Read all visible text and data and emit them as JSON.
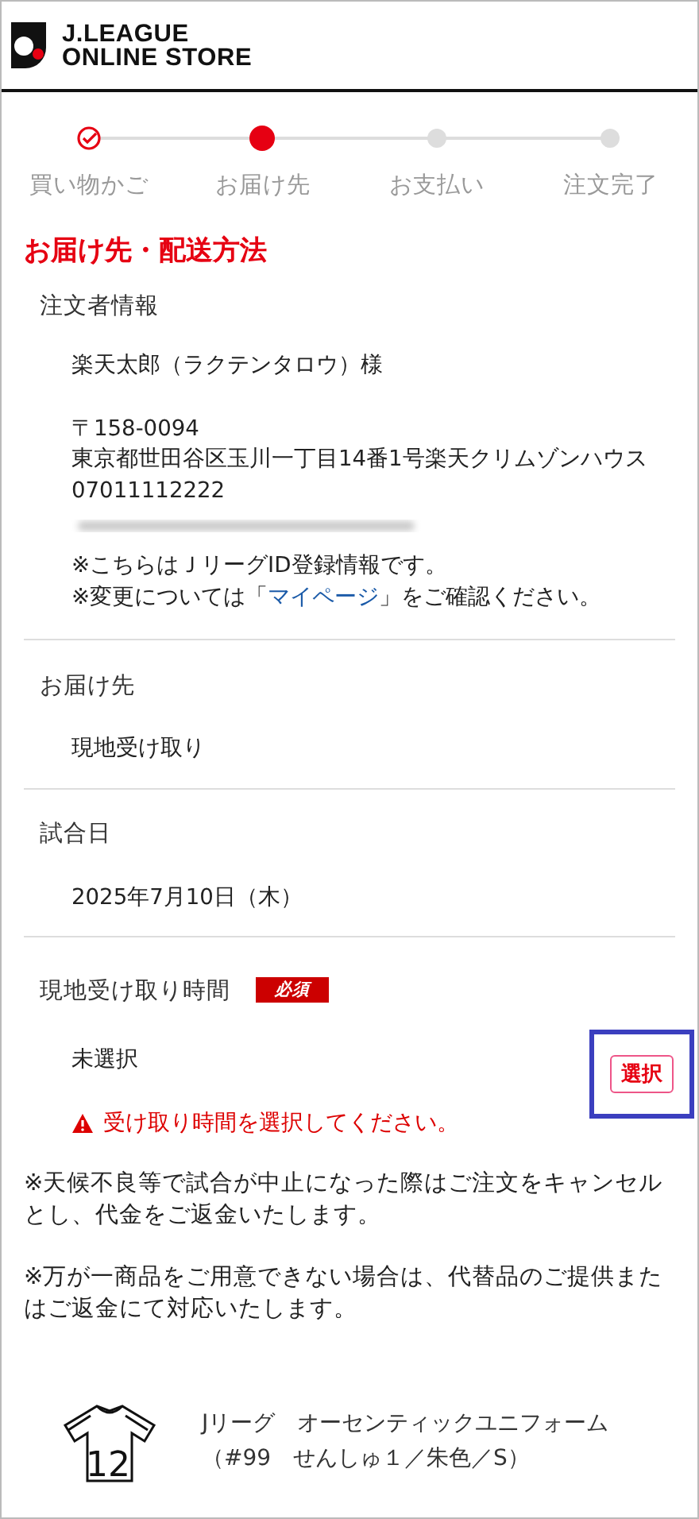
{
  "header": {
    "logo_line_1": "J.LEAGUE",
    "logo_line_2": "ONLINE STORE"
  },
  "steps": [
    {
      "label": "買い物かご",
      "kind": "done"
    },
    {
      "label": "お届け先",
      "kind": "current"
    },
    {
      "label": "お支払い",
      "kind": "todo"
    },
    {
      "label": "注文完了",
      "kind": "todo"
    }
  ],
  "page_title": "お届け先・配送方法",
  "orderer": {
    "heading": "注文者情報",
    "name": "楽天太郎（ラクテンタロウ）様",
    "address_lines": [
      "〒158-0094",
      "東京都世田谷区玉川一丁目14番1号楽天クリムゾンハウス",
      "07011112222"
    ],
    "notes": [
      {
        "text": "※こちらはＪリーグID登録情報です。"
      },
      {
        "text": "※変更については「",
        "link": "マイページ",
        "after": "」をご確認ください。"
      }
    ]
  },
  "sections": [
    {
      "heading": "お届け先",
      "value": "現地受け取り"
    },
    {
      "heading": "試合日",
      "value": "2025年7月10日（木）"
    }
  ],
  "pickup_time": {
    "heading": "現地受け取り時間",
    "badge": "必須",
    "value": "未選択",
    "error": "受け取り時間を選択してください。",
    "button": {
      "label": "選択",
      "highlighted": true
    }
  },
  "notices": [
    "※天候不良等で試合が中止になった際はご注文をキャンセルとし、代金をご返金いたします。",
    "※万が一商品をご用意できない場合は、代替品のご提供またはご返金にて対応いたします。"
  ],
  "product": {
    "image_number": "12",
    "name": "Jリーグ　オーセンティックユニフォーム",
    "variant": "（#99　せんしゅ１／朱色／S）"
  }
}
